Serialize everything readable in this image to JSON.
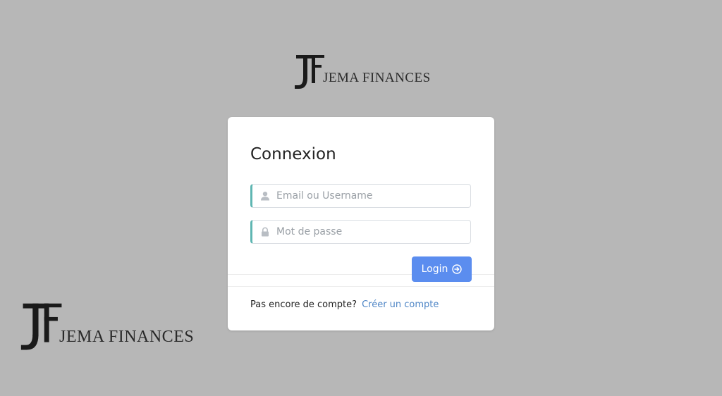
{
  "branding": {
    "name": "JEMA FINANCES"
  },
  "login": {
    "title": "Connexion",
    "email_placeholder": "Email ou Username",
    "email_value": "",
    "password_placeholder": "Mot de passe",
    "password_value": "",
    "submit_label": "Login",
    "no_account_text": "Pas encore de compte?",
    "create_account_label": "Créer un compte"
  },
  "icons": {
    "email_field": "user-icon",
    "password_field": "lock-icon",
    "submit": "circle-arrow-right-icon"
  },
  "colors": {
    "background": "#b7b7b7",
    "accent": "#5b8def",
    "field_accent": "#5fb6b2",
    "link": "#4f86c6"
  }
}
